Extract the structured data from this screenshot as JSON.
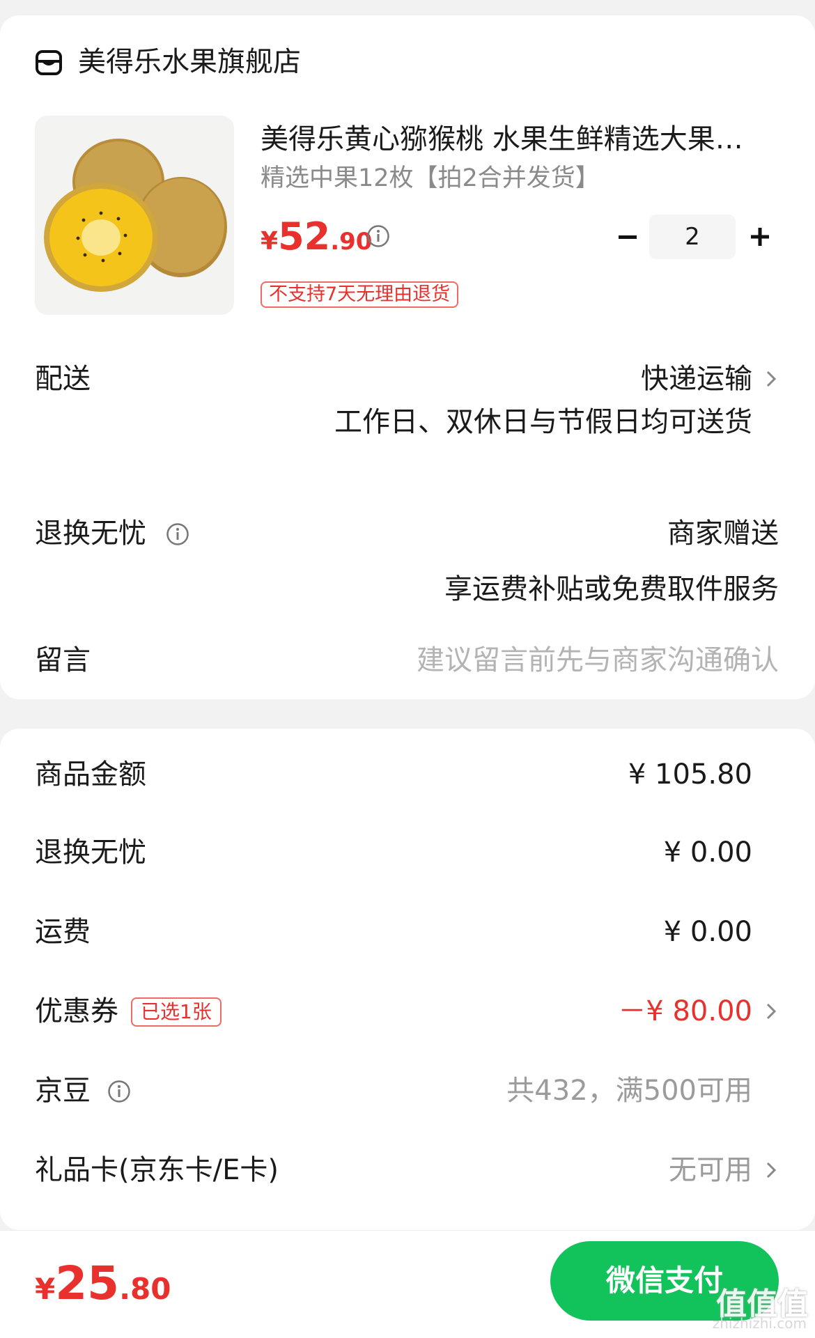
{
  "store": {
    "name": "美得乐水果旗舰店",
    "icon": "store-icon"
  },
  "product": {
    "title": "美得乐黄心猕猴桃 水果生鲜精选大果…",
    "spec": "精选中果12枚【拍2合并发货】",
    "price_currency": "¥",
    "price_int": "52",
    "price_dec": ".90",
    "quantity": "2",
    "qty_minus": "−",
    "qty_plus": "+",
    "return_badge": "不支持7天无理由退货"
  },
  "delivery": {
    "label": "配送",
    "method": "快递运输",
    "note": "工作日、双休日与节假日均可送货"
  },
  "worry_free": {
    "label": "退换无忧",
    "value": "商家赠送",
    "note": "享运费补贴或免费取件服务"
  },
  "message": {
    "label": "留言",
    "placeholder": "建议留言前先与商家沟通确认"
  },
  "summary": {
    "goods_label": "商品金额",
    "goods_value": "¥ 105.80",
    "worry_label": "退换无忧",
    "worry_value": "¥ 0.00",
    "shipping_label": "运费",
    "shipping_value": "¥ 0.00",
    "coupon_label": "优惠券",
    "coupon_badge": "已选1张",
    "coupon_value": "－¥ 80.00",
    "jd_bean_label": "京豆",
    "jd_bean_value": "共432，满500可用",
    "gift_card_label": "礼品卡(京东卡/E卡)",
    "gift_card_value": "无可用"
  },
  "bottom": {
    "total_currency": "¥",
    "total_int": "25",
    "total_dec": ".80",
    "pay_label": "微信支付",
    "watermark": "值值值",
    "watermark_sub": "zhizhizhi.com"
  },
  "colors": {
    "accent_red": "#e8312d",
    "pay_green": "#12c25b"
  }
}
